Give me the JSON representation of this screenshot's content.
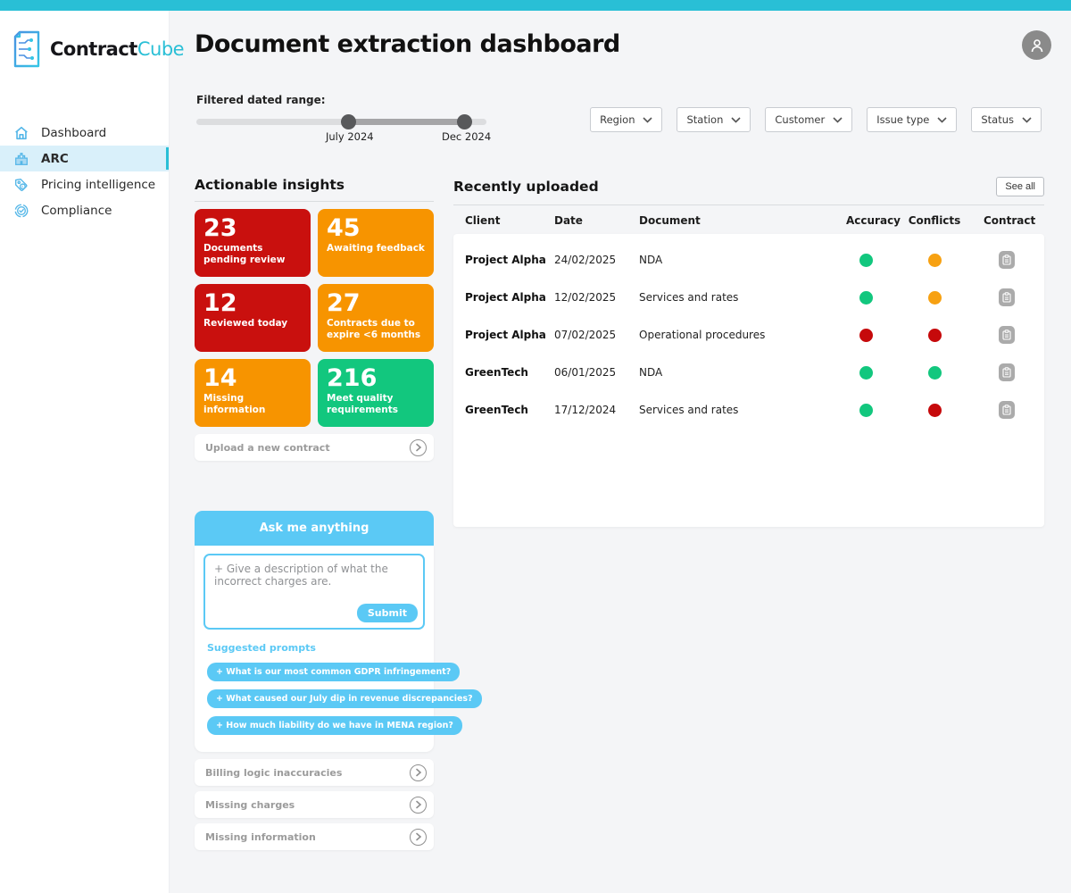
{
  "topbar": {
    "color": "#29BFD6"
  },
  "brand": {
    "name_primary": "Contract",
    "name_secondary": "Cube"
  },
  "sidebar": {
    "items": [
      {
        "label": "Dashboard",
        "icon": "home-icon",
        "active": false
      },
      {
        "label": "ARC",
        "icon": "building-icon",
        "active": true
      },
      {
        "label": "Pricing intelligence",
        "icon": "price-tag-icon",
        "active": false
      },
      {
        "label": "Compliance",
        "icon": "shield-check-icon",
        "active": false
      }
    ]
  },
  "header": {
    "title": "Document extraction dashboard",
    "avatar_icon": "user-icon"
  },
  "filters": {
    "date_range_label": "Filtered dated range:",
    "range_start_label": "July 2024",
    "range_end_label": "Dec 2024",
    "dropdowns": [
      {
        "label": "Region"
      },
      {
        "label": "Station"
      },
      {
        "label": "Customer"
      },
      {
        "label": "Issue type"
      },
      {
        "label": "Status"
      }
    ]
  },
  "insights": {
    "title": "Actionable insights",
    "cards": [
      {
        "value": "23",
        "label": "Documents pending review",
        "color": "#C9100E"
      },
      {
        "value": "45",
        "label": "Awaiting feedback",
        "color": "#F79400"
      },
      {
        "value": "12",
        "label": "Reviewed today",
        "color": "#C9100E"
      },
      {
        "value": "27",
        "label": "Contracts due to expire <6 months",
        "color": "#F79400"
      },
      {
        "value": "14",
        "label": "Missing information",
        "color": "#F79400"
      },
      {
        "value": "216",
        "label": "Meet quality requirements",
        "color": "#12C77E"
      }
    ],
    "upload_label": "Upload a new contract"
  },
  "table": {
    "title": "Recently uploaded",
    "see_all_label": "See all",
    "columns": [
      "Client",
      "Date",
      "Document",
      "Accuracy",
      "Conflicts",
      "Contract"
    ],
    "rows": [
      {
        "client": "Project Alpha",
        "date": "24/02/2025",
        "document": "NDA",
        "accuracy": "green",
        "conflicts": "orange"
      },
      {
        "client": "Project Alpha",
        "date": "12/02/2025",
        "document": "Services and rates",
        "accuracy": "green",
        "conflicts": "orange"
      },
      {
        "client": "Project Alpha",
        "date": "07/02/2025",
        "document": "Operational procedures",
        "accuracy": "red",
        "conflicts": "red"
      },
      {
        "client": "GreenTech",
        "date": "06/01/2025",
        "document": "NDA",
        "accuracy": "green",
        "conflicts": "green"
      },
      {
        "client": "GreenTech",
        "date": "17/12/2024",
        "document": "Services and rates",
        "accuracy": "green",
        "conflicts": "red"
      }
    ]
  },
  "assistant": {
    "title": "Ask me anything",
    "placeholder": "+ Give a description of what the incorrect charges are.",
    "submit_label": "Submit",
    "suggested_title": "Suggested prompts",
    "prompts": [
      {
        "label": "+ What is our most common GDPR infringement?"
      },
      {
        "label": "+ What caused our July dip in revenue discrepancies?"
      },
      {
        "label": "+ How much liability do we have in MENA region?"
      }
    ]
  },
  "accordions": [
    {
      "label": "Billing logic inaccuracies"
    },
    {
      "label": "Missing charges"
    },
    {
      "label": "Missing information"
    }
  ],
  "colors": {
    "status": {
      "green": "#12C77E",
      "orange": "#F7A112",
      "red": "#C6090B"
    },
    "accent_cyan": "#29BFD6",
    "accent_blue": "#5BC9F5"
  }
}
